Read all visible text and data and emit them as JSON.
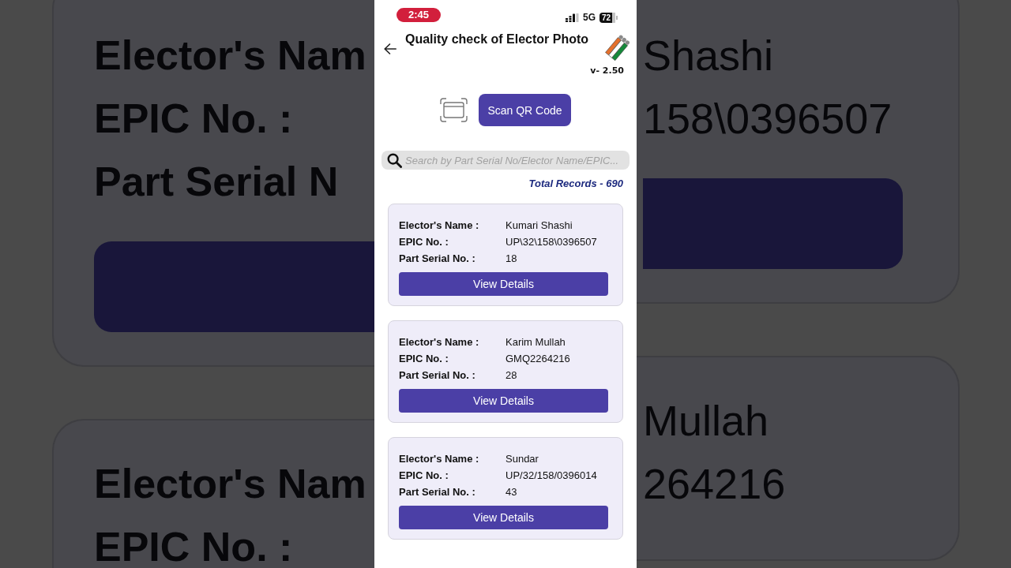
{
  "status_bar": {
    "time": "2:45",
    "network": "5G",
    "battery": "72"
  },
  "header": {
    "title": "Quality check of Elector Photo",
    "version": "v- 2.50"
  },
  "scan_button": {
    "label": "Scan QR Code"
  },
  "search": {
    "placeholder": "Search by Part Serial No/Elector Name/EPIC..."
  },
  "total_records": "Total Records - 690",
  "records": [
    {
      "fields": [
        {
          "label": "Elector's Name :",
          "value": "Kumari Shashi"
        },
        {
          "label": "EPIC No. :",
          "value": "UP\\32\\158\\0396507"
        },
        {
          "label": "Part Serial No. :",
          "value": "18"
        }
      ],
      "button": "View Details"
    },
    {
      "fields": [
        {
          "label": "Elector's Name :",
          "value": "Karim Mullah"
        },
        {
          "label": "EPIC No. :",
          "value": "GMQ2264216"
        },
        {
          "label": "Part Serial No. :",
          "value": "28"
        }
      ],
      "button": "View Details"
    },
    {
      "fields": [
        {
          "label": "Elector's Name :",
          "value": "Sundar"
        },
        {
          "label": "EPIC No. :",
          "value": "UP/32/158/0396014"
        },
        {
          "label": "Part Serial No. :",
          "value": "43"
        }
      ],
      "button": "View Details"
    }
  ],
  "backdrop": {
    "left": [
      {
        "labels": [
          "Elector's Nam",
          "EPIC No. :",
          "Part Serial N"
        ],
        "button": true
      },
      {
        "labels": [
          "Elector's Nam",
          "EPIC No. :"
        ]
      }
    ],
    "right": [
      {
        "values": [
          "Shashi",
          "158\\0396507"
        ],
        "button": true
      },
      {
        "values": [
          "Mullah",
          "264216"
        ]
      }
    ]
  }
}
